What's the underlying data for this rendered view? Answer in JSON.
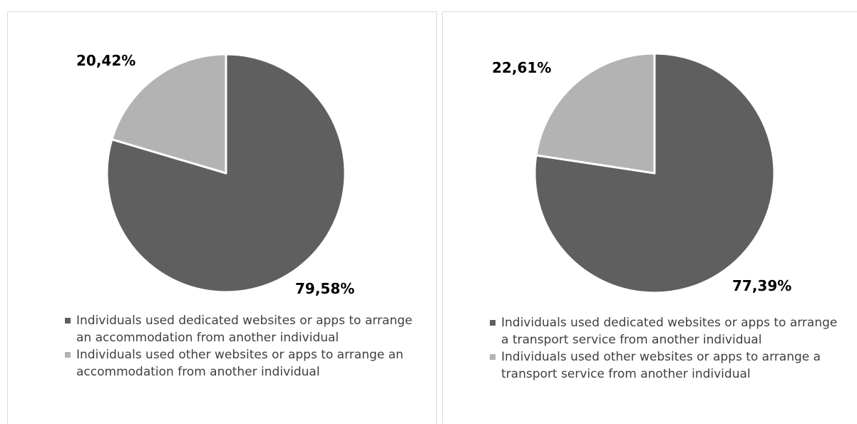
{
  "chart_data": [
    {
      "type": "pie",
      "slices": [
        {
          "label": "Individuals used dedicated websites or apps to arrange an accommodation from another individual",
          "value": 79.58,
          "display": "79,58%",
          "color": "#5f5f5f"
        },
        {
          "label": "Individuals used other websites or apps to arrange an accommodation from another individual",
          "value": 20.42,
          "display": "20,42%",
          "color": "#b3b3b3"
        }
      ],
      "start_angle_deg": 0,
      "direction": "clockwise",
      "legend_position": "bottom"
    },
    {
      "type": "pie",
      "slices": [
        {
          "label": "Individuals used dedicated websites or apps to arrange a transport service from another individual",
          "value": 77.39,
          "display": "77,39%",
          "color": "#5f5f5f"
        },
        {
          "label": "Individuals used other websites or apps to arrange a transport service from another individual",
          "value": 22.61,
          "display": "22,61%",
          "color": "#b3b3b3"
        }
      ],
      "start_angle_deg": 0,
      "direction": "clockwise",
      "legend_position": "bottom"
    }
  ],
  "colors": {
    "slice_border": "#ffffff",
    "panel_border": "#d9d9d9",
    "legend_text": "#404040"
  }
}
